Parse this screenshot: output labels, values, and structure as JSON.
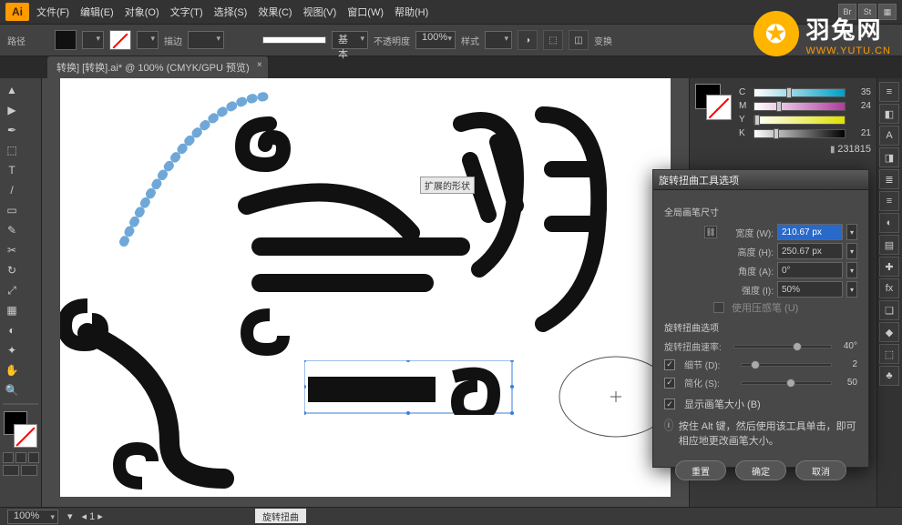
{
  "app": "Ai",
  "menus": [
    "文件(F)",
    "编辑(E)",
    "对象(O)",
    "文字(T)",
    "选择(S)",
    "效果(C)",
    "视图(V)",
    "窗口(W)",
    "帮助(H)"
  ],
  "badges": [
    "Br",
    "St",
    ""
  ],
  "ctrl": {
    "panelLabel": "路径",
    "strokeLbl": "描边",
    "strokeDD": "",
    "styleLbl": "基本",
    "opacityLbl": "不透明度",
    "opacity": "100%",
    "styleBtn": "样式",
    "transform": "变换"
  },
  "tab": {
    "title": "转换] [转换].ai* @ 100% (CMYK/GPU 预览)",
    "close": "×"
  },
  "obj_tag": "扩展的形状",
  "color": {
    "channels": [
      {
        "ch": "C",
        "val": "35",
        "color": "linear-gradient(90deg,#fff,#00a0c6)",
        "pos": "35%"
      },
      {
        "ch": "M",
        "val": "24",
        "color": "linear-gradient(90deg,#fff,#b23aa0)",
        "pos": "24%"
      },
      {
        "ch": "Y",
        "val": "",
        "color": "linear-gradient(90deg,#fff,#e0e000)",
        "pos": "0%"
      },
      {
        "ch": "K",
        "val": "21",
        "color": "linear-gradient(90deg,#fff,#000)",
        "pos": "21%"
      }
    ],
    "hex": "231815"
  },
  "dlg": {
    "title": "旋转扭曲工具选项",
    "group1": "全局画笔尺寸",
    "width_l": "宽度 (W):",
    "width_v": "210.67 px",
    "height_l": "高度 (H):",
    "height_v": "250.67 px",
    "angle_l": "角度 (A):",
    "angle_v": "0°",
    "intens_l": "强度 (I):",
    "intens_v": "50%",
    "pressure": "使用压感笔 (U)",
    "group2": "旋转扭曲选项",
    "rate_l": "旋转扭曲速率:",
    "rate_v": "40°",
    "detail_l": "细节 (D):",
    "detail_v": "2",
    "simplify_l": "简化 (S):",
    "simplify_v": "50",
    "showBrush": "显示画笔大小 (B)",
    "tip": "按住 Alt 键，然后使用该工具单击，即可相应地更改画笔大小。",
    "reset": "重置",
    "ok": "确定",
    "cancel": "取消"
  },
  "watermark": {
    "cn": "羽兔网",
    "en": "WWW.YUTU.CN"
  },
  "status": {
    "zoom": "100%",
    "tool": "旋转扭曲"
  },
  "tools": [
    "▲",
    "▶",
    "✒",
    "⬚",
    "T",
    "/",
    "▭",
    "✎",
    "✂",
    "↻",
    "⤢",
    "▦",
    "◐",
    "✦",
    "✋",
    "🔍"
  ],
  "righticons": [
    "≡",
    "◧",
    "A",
    "◨",
    "≣",
    "≡",
    "◐",
    "▤",
    "✚",
    "fx",
    "❏",
    "◆",
    "⬚",
    "♣"
  ]
}
